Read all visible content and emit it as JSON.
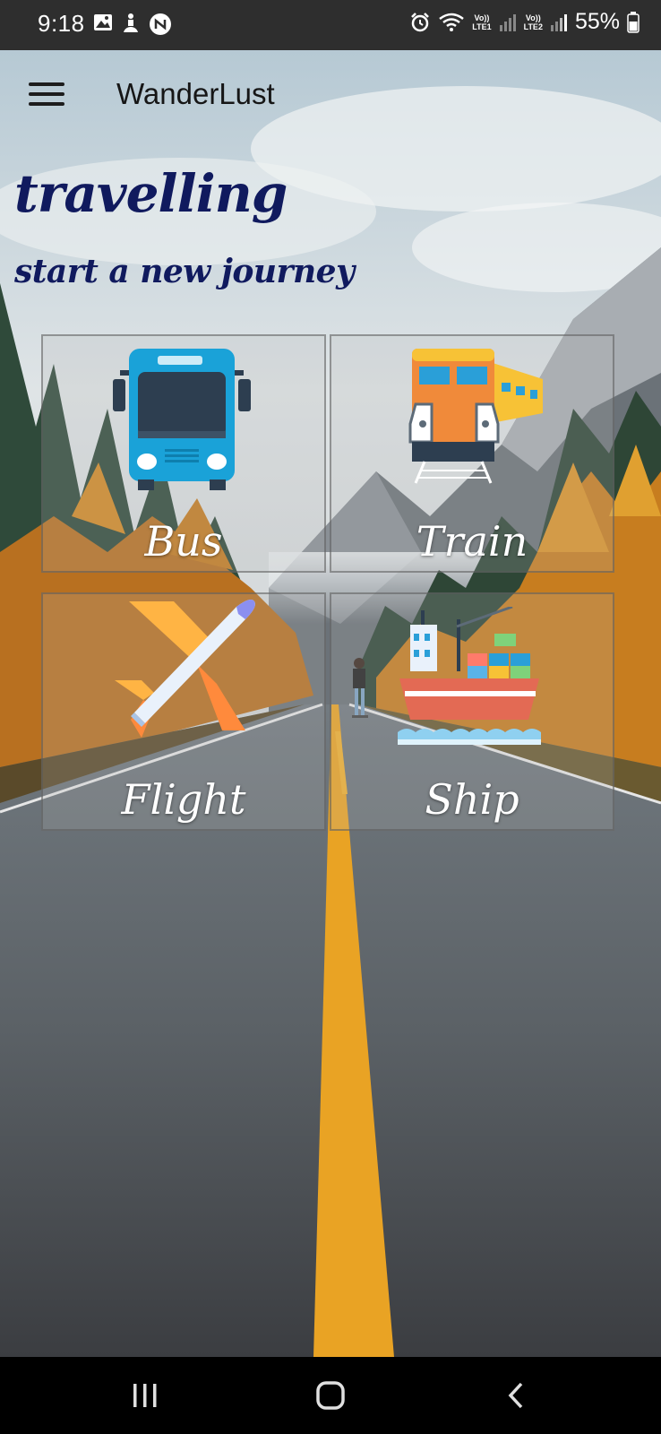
{
  "status_bar": {
    "time": "9:18",
    "lte1": [
      "Vo))",
      "LTE1"
    ],
    "lte2": [
      "Vo))",
      "LTE2"
    ],
    "battery": "55%"
  },
  "toolbar": {
    "app_title": "WanderLust",
    "menu_icon": "hamburger-menu-icon"
  },
  "hero": {
    "headline": "travelling",
    "subhead": "start a new journey"
  },
  "options": [
    {
      "label": "Bus",
      "icon": "bus-icon"
    },
    {
      "label": "Train",
      "icon": "train-icon"
    },
    {
      "label": "Flight",
      "icon": "airplane-icon"
    },
    {
      "label": "Ship",
      "icon": "cargo-ship-icon"
    }
  ],
  "nav_bar": {
    "recents": "recents-icon",
    "home": "home-icon",
    "back": "back-icon"
  },
  "colors": {
    "headline": "#101a5e",
    "road_line": "#f0a81e",
    "bus_body": "#1aa2d8",
    "train_body": "#f08a3a",
    "plane_wing": "#ff9a3c"
  }
}
